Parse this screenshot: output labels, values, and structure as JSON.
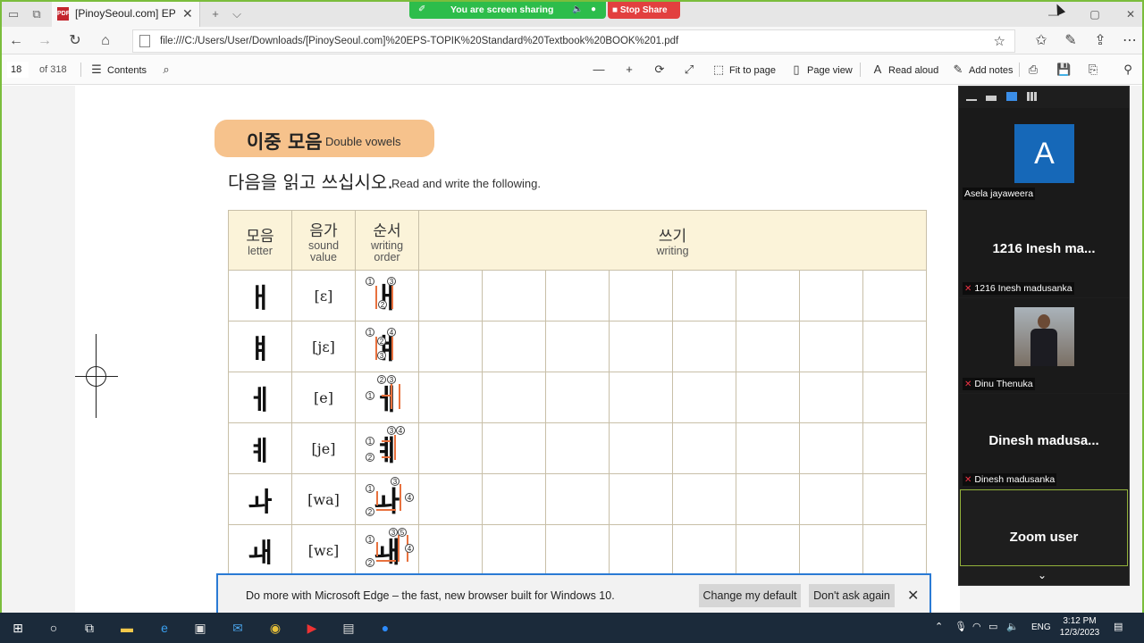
{
  "browser": {
    "tab_title": "[PinoySeoul.com] EPS-T",
    "tab_close": "✕",
    "new_tab": "+",
    "tab_dropdown": "⌵",
    "url": "file:///C:/Users/User/Downloads/[PinoySeoul.com]%20EPS-TOPIK%20Standard%20Textbook%20BOOK%201.pdf"
  },
  "sharing": {
    "text": "You are screen sharing",
    "stop_label": "Stop Share"
  },
  "pdf_toolbar": {
    "page_number": "18",
    "page_total": "of 318",
    "contents": "Contents",
    "fit_to_page": "Fit to page",
    "page_view": "Page view",
    "read_aloud": "Read aloud",
    "add_notes": "Add notes"
  },
  "document": {
    "section_title_ko": "이중 모음",
    "section_title_en": "Double vowels",
    "instruction_ko": "다음을 읽고 쓰십시오.",
    "instruction_en": "Read and write the following.",
    "headers": [
      {
        "ko": "모음",
        "en": "letter"
      },
      {
        "ko": "음가",
        "en": "sound value"
      },
      {
        "ko": "순서",
        "en": "writing order"
      },
      {
        "ko": "쓰기",
        "en": "writing"
      }
    ],
    "rows": [
      {
        "letter": "ㅐ",
        "sound": "[ɛ]"
      },
      {
        "letter": "ㅒ",
        "sound": "[jɛ]"
      },
      {
        "letter": "ㅔ",
        "sound": "[e]"
      },
      {
        "letter": "ㅖ",
        "sound": "[je]"
      },
      {
        "letter": "ㅘ",
        "sound": "[wa]"
      },
      {
        "letter": "ㅙ",
        "sound": "[wɛ]"
      }
    ]
  },
  "zoom": {
    "participants": [
      {
        "name": "Asela jayaweera",
        "avatar_letter": "A"
      },
      {
        "name": "1216  Inesh madusanka",
        "display": "1216   Inesh ma..."
      },
      {
        "name": "Dinu Thenuka"
      },
      {
        "name": "Dinesh madusanka",
        "display": "Dinesh  madusa..."
      },
      {
        "name": "Zoom user",
        "display": "Zoom user"
      }
    ]
  },
  "edge_notice": {
    "message": "Do more with Microsoft Edge – the fast, new browser built for Windows 10.",
    "change_default": "Change my default",
    "dont_ask": "Don't ask again"
  },
  "taskbar": {
    "language": "ENG",
    "time": "3:12 PM",
    "date": "12/3/2023"
  },
  "colors": {
    "accent_green": "#7bbd3c",
    "share_green": "#2dbd4b",
    "stop_red": "#e2403f",
    "pill_orange": "#f6c28c",
    "header_cream": "#fbf3d9",
    "arrow_orange": "#e8713e",
    "zoom_blue": "#1668b8"
  }
}
